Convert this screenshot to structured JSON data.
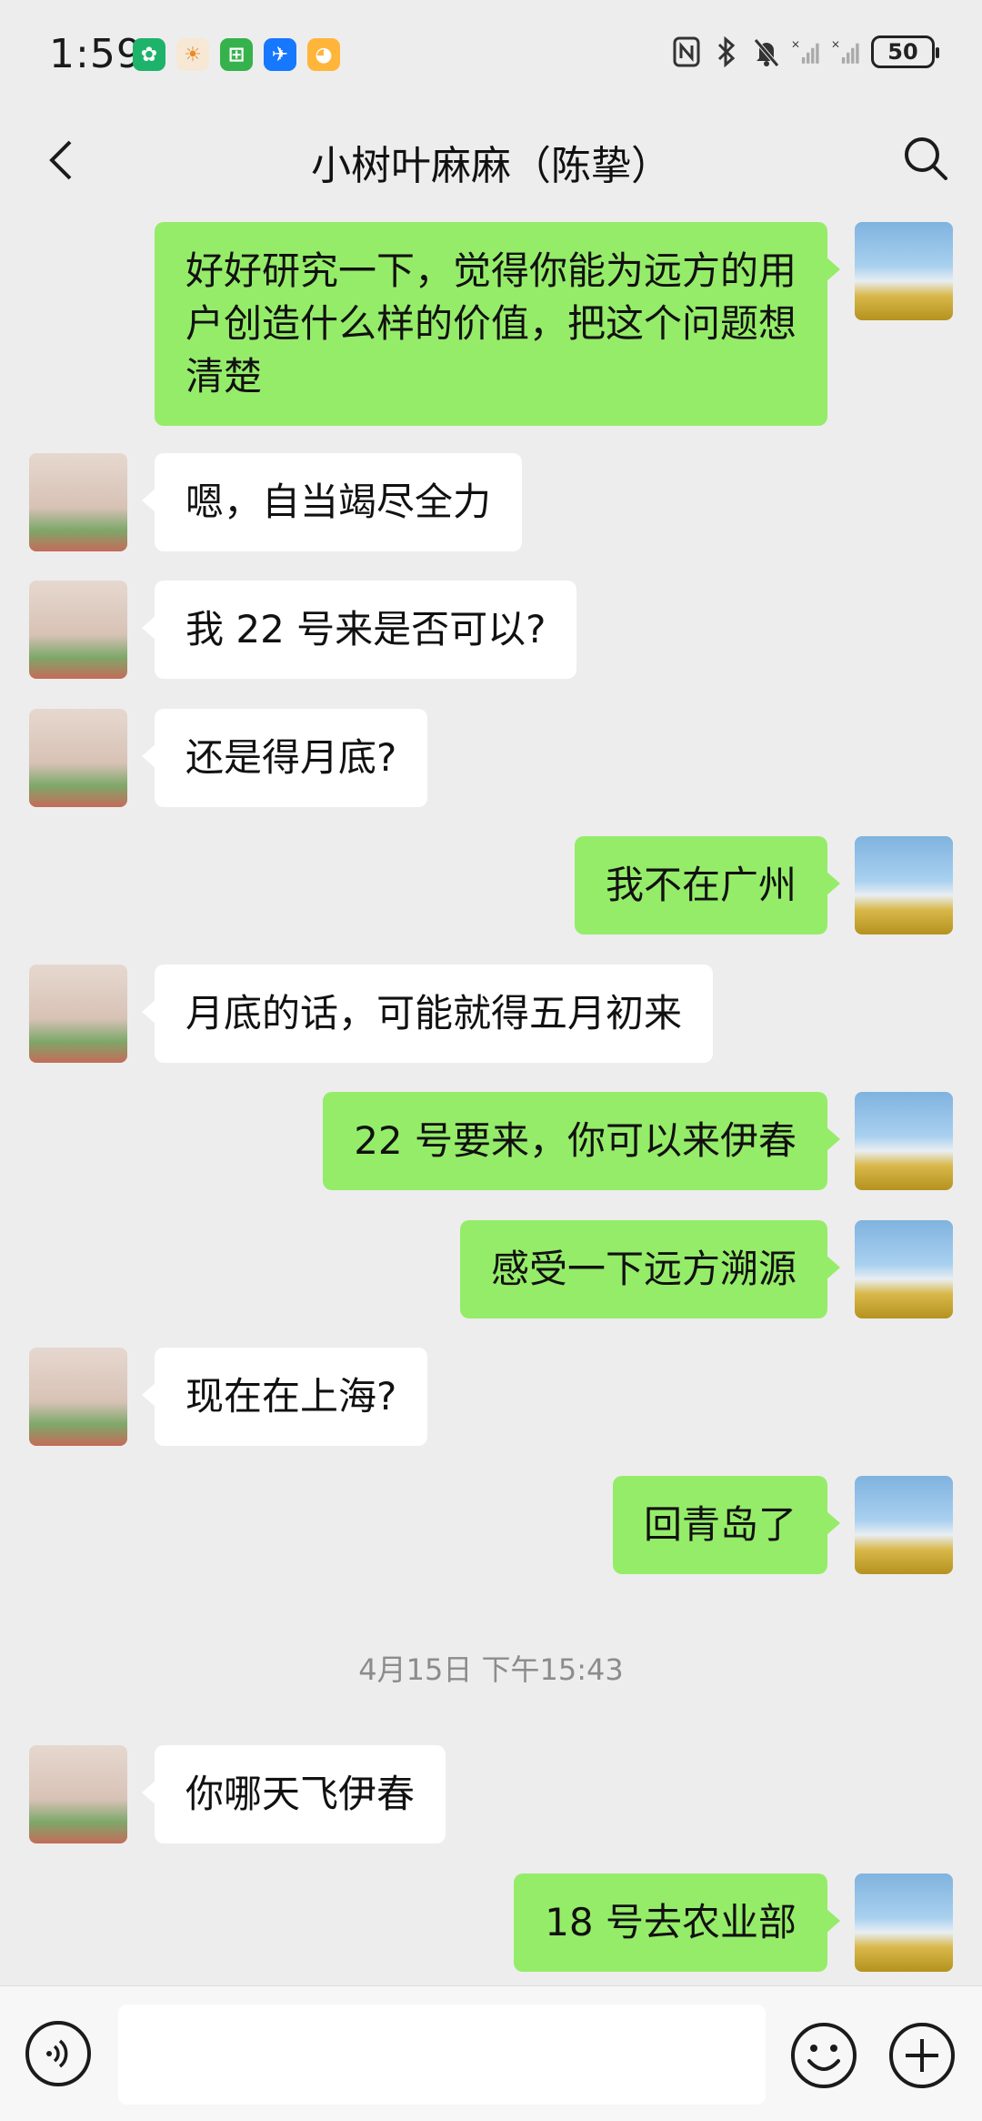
{
  "status_bar": {
    "time": "1:59",
    "battery": "50",
    "app_icons": [
      "app-icon-green",
      "app-icon-orange",
      "app-icon-green-square",
      "app-icon-blue-plane",
      "app-icon-yellow-duck"
    ]
  },
  "header": {
    "title": "小树叶麻麻（陈挚）"
  },
  "messages": [
    {
      "side": "right",
      "text": "好好研究一下，觉得你能为远方的用户创造什么样的价值，把这个问题想清楚"
    },
    {
      "side": "left",
      "text": "嗯，自当竭尽全力"
    },
    {
      "side": "left",
      "text": "我 22 号来是否可以?"
    },
    {
      "side": "left",
      "text": "还是得月底?"
    },
    {
      "side": "right",
      "text": "我不在广州"
    },
    {
      "side": "left",
      "text": "月底的话，可能就得五月初来"
    },
    {
      "side": "right",
      "text": "22 号要来，你可以来伊春"
    },
    {
      "side": "right",
      "text": "感受一下远方溯源"
    },
    {
      "side": "left",
      "text": "现在在上海?"
    },
    {
      "side": "right",
      "text": "回青岛了"
    },
    {
      "side": "left",
      "text": "你哪天飞伊春"
    },
    {
      "side": "right",
      "text": "18 号去农业部"
    }
  ],
  "timestamp": "4月15日 下午15:43",
  "input": {
    "value": "",
    "placeholder": ""
  },
  "colors": {
    "background": "#ededed",
    "bubble_sent": "#95ec69",
    "bubble_received": "#ffffff"
  }
}
